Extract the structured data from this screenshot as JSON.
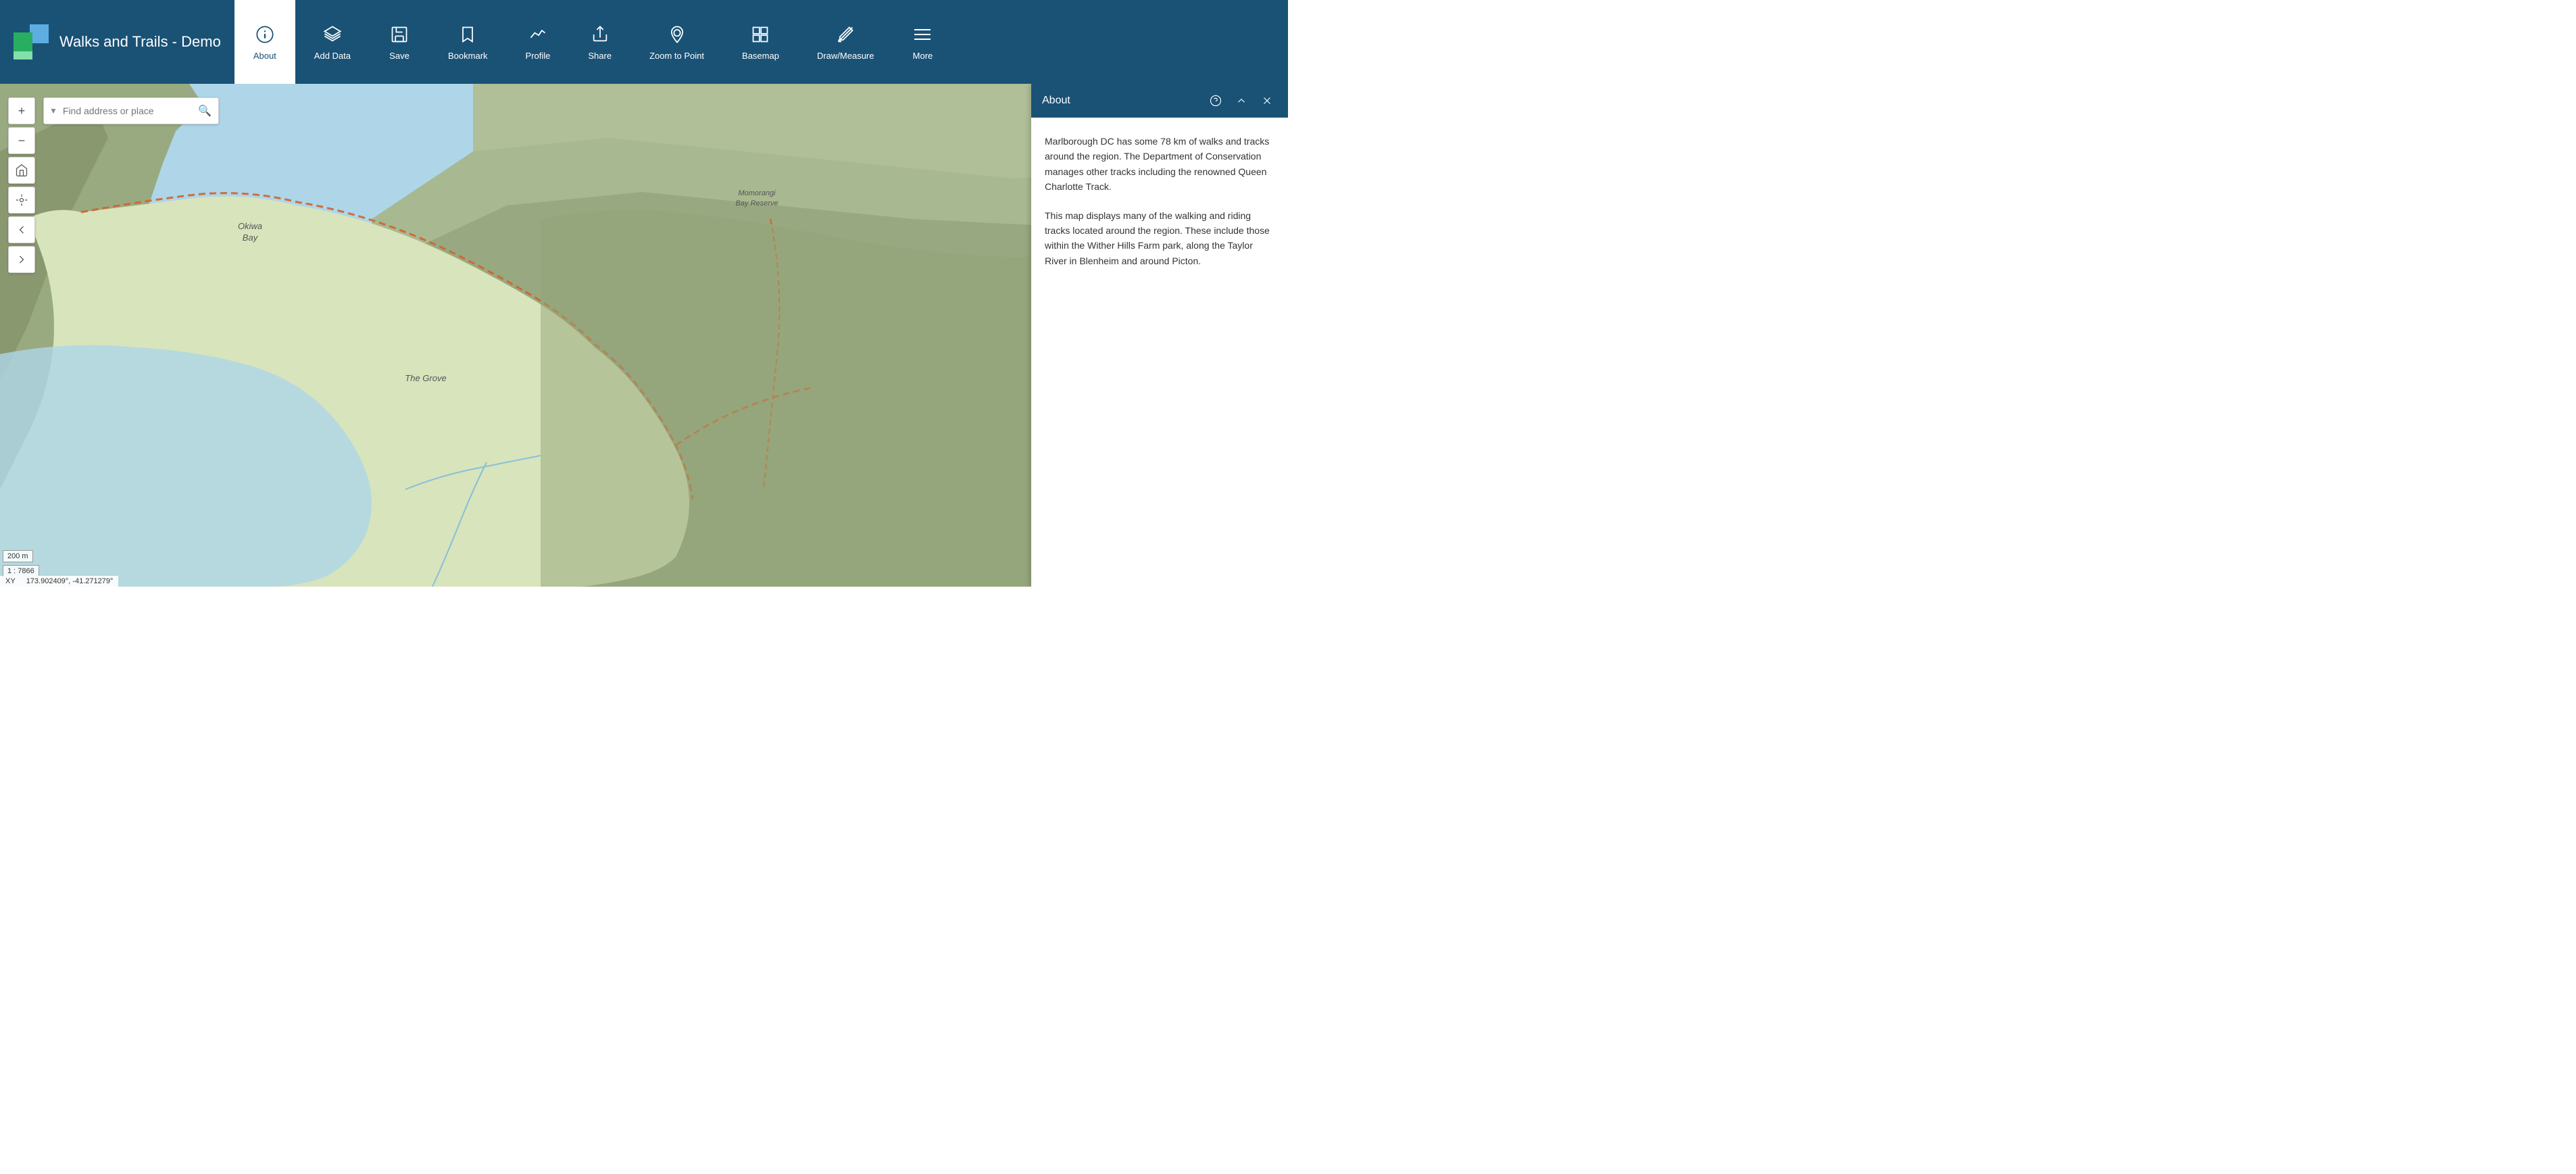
{
  "header": {
    "title": "Walks and Trails - Demo",
    "nav": [
      {
        "id": "about",
        "label": "About",
        "icon": "info",
        "active": true
      },
      {
        "id": "add-data",
        "label": "Add Data",
        "icon": "layers",
        "active": false
      },
      {
        "id": "save",
        "label": "Save",
        "icon": "save",
        "active": false
      },
      {
        "id": "bookmark",
        "label": "Bookmark",
        "icon": "bookmark",
        "active": false
      },
      {
        "id": "profile",
        "label": "Profile",
        "icon": "profile",
        "active": false
      },
      {
        "id": "share",
        "label": "Share",
        "icon": "share",
        "active": false
      },
      {
        "id": "zoom-to-point",
        "label": "Zoom to Point",
        "icon": "zoom-point",
        "active": false
      },
      {
        "id": "basemap",
        "label": "Basemap",
        "icon": "basemap",
        "active": false
      },
      {
        "id": "draw-measure",
        "label": "Draw/Measure",
        "icon": "draw",
        "active": false
      },
      {
        "id": "more",
        "label": "More",
        "icon": "more",
        "active": false
      }
    ]
  },
  "search": {
    "placeholder": "Find address or place"
  },
  "about_panel": {
    "title": "About",
    "paragraph1": "Marlborough DC has some 78 km of walks and tracks around the region. The Department of Conservation manages other tracks including the renowned Queen Charlotte Track.",
    "paragraph2": "This map displays many of the walking and riding tracks located around the region. These include those within the Wither Hills Farm park, along the Taylor River in Blenheim and around Picton."
  },
  "map": {
    "scale_text": "200 m",
    "scale_ratio": "1 : 7866",
    "coords_label": "XY",
    "coords_value": "173.902409°, -41.271279°",
    "place1": "Okiwa Bay",
    "place2": "The Grove",
    "place3": "Momorangi Bay Reserve"
  },
  "colors": {
    "header_bg": "#1a5276",
    "water": "#aed6e8",
    "terrain_light": "#c8d5b0",
    "terrain_dark": "#8fa87a",
    "trail": "#d4622a"
  }
}
